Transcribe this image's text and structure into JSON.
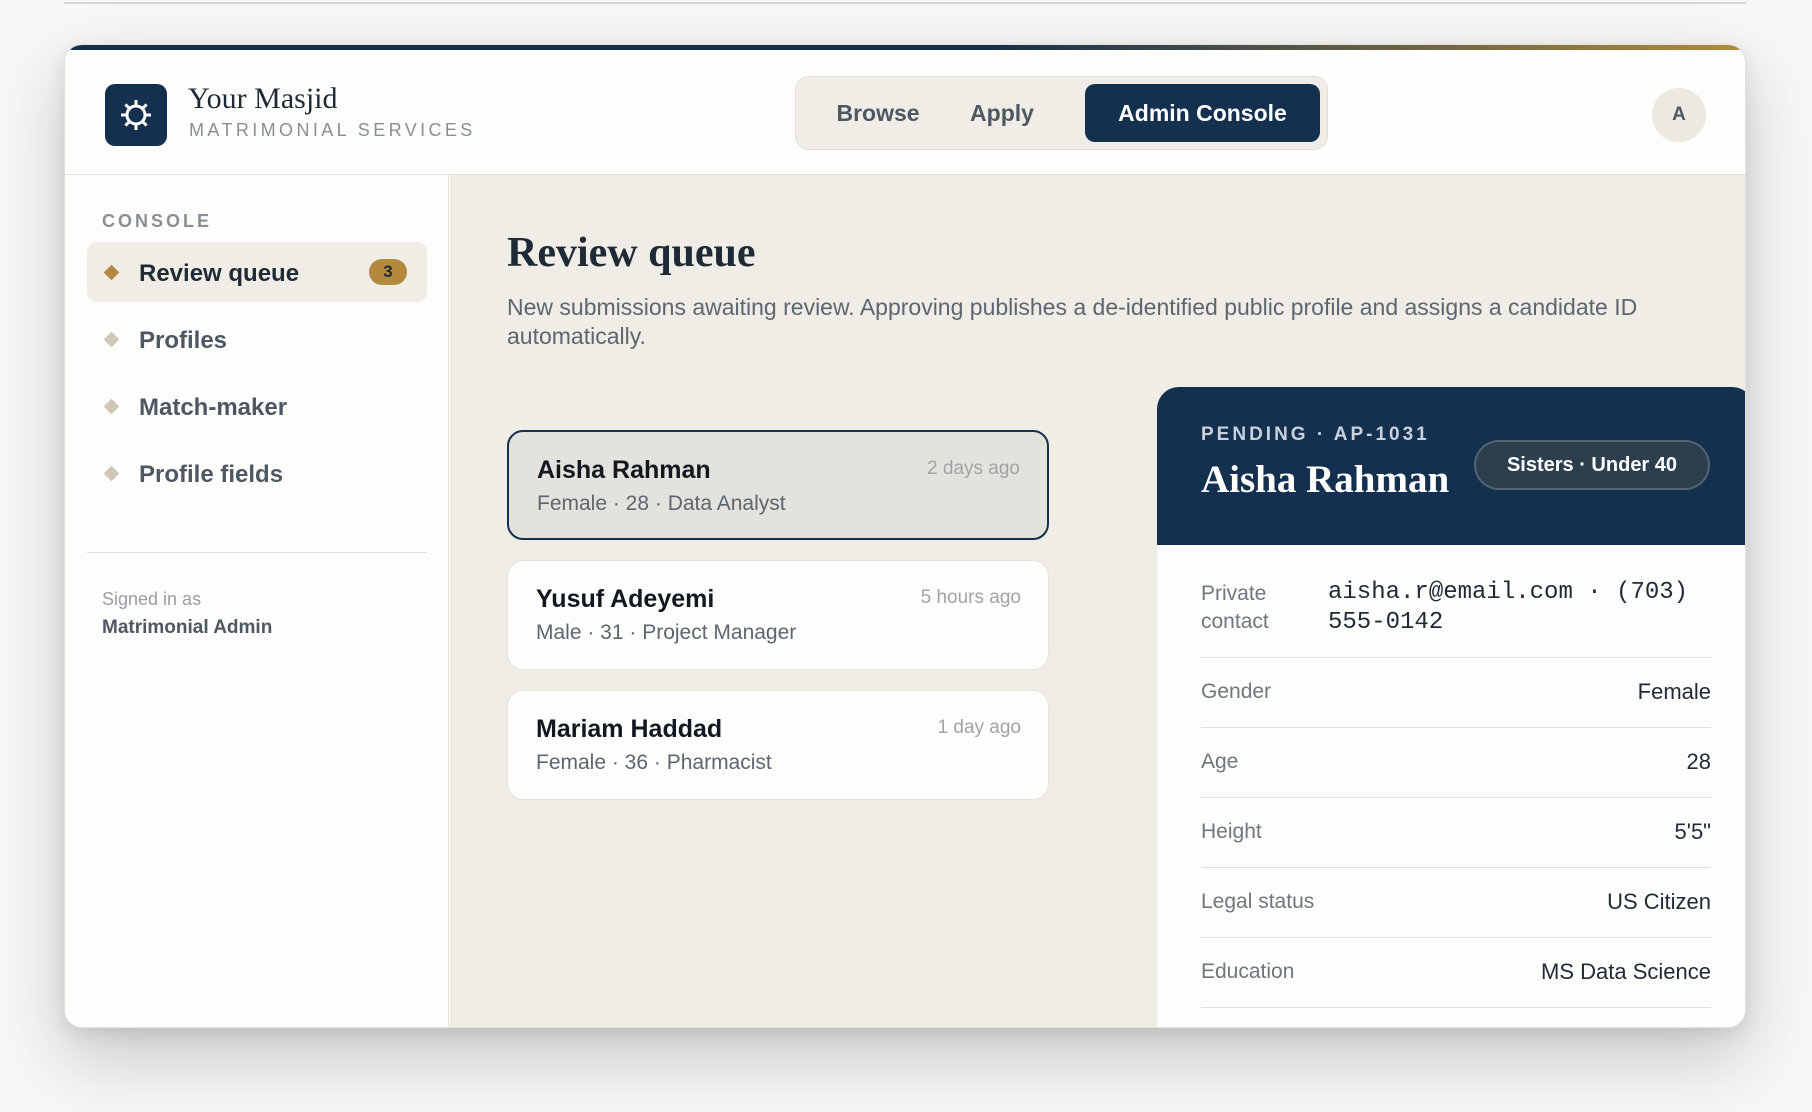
{
  "app": {
    "brand_title": "Your Masjid",
    "brand_subtitle": "MATRIMONIAL SERVICES",
    "logo_icon": "gear-star-icon",
    "accent_color": "#14304f",
    "gold_color": "#b38a3d"
  },
  "nav": {
    "tabs": [
      {
        "label": "Browse"
      },
      {
        "label": "Apply"
      },
      {
        "label": "Admin Console",
        "active": true
      }
    ]
  },
  "user": {
    "avatar_initial": "A"
  },
  "sidebar": {
    "heading": "CONSOLE",
    "items": [
      {
        "label": "Review queue",
        "badge": "3",
        "active": true
      },
      {
        "label": "Profiles"
      },
      {
        "label": "Match-maker"
      },
      {
        "label": "Profile fields"
      }
    ],
    "signed_in_label": "Signed in as",
    "signed_in_name": "Matrimonial Admin"
  },
  "main": {
    "title": "Review queue",
    "description": "New submissions awaiting review. Approving publishes a de-identified public profile and assigns a candidate ID automatically.",
    "queue": [
      {
        "name": "Aisha Rahman",
        "meta": "Female · 28 · Data Analyst",
        "time": "2 days ago",
        "selected": true
      },
      {
        "name": "Yusuf Adeyemi",
        "meta": "Male · 31 · Project Manager",
        "time": "5 hours ago"
      },
      {
        "name": "Mariam Haddad",
        "meta": "Female · 36 · Pharmacist",
        "time": "1 day ago"
      }
    ]
  },
  "detail": {
    "status": "PENDING · AP-1031",
    "name": "Aisha Rahman",
    "tag": "Sisters · Under 40",
    "contact_label": "Private contact",
    "contact_value": "aisha.r@email.com · (703) 555-0142",
    "fields": [
      {
        "label": "Gender",
        "value": "Female"
      },
      {
        "label": "Age",
        "value": "28"
      },
      {
        "label": "Height",
        "value": "5'5\""
      },
      {
        "label": "Legal status",
        "value": "US Citizen"
      },
      {
        "label": "Education",
        "value": "MS Data Science"
      }
    ]
  }
}
